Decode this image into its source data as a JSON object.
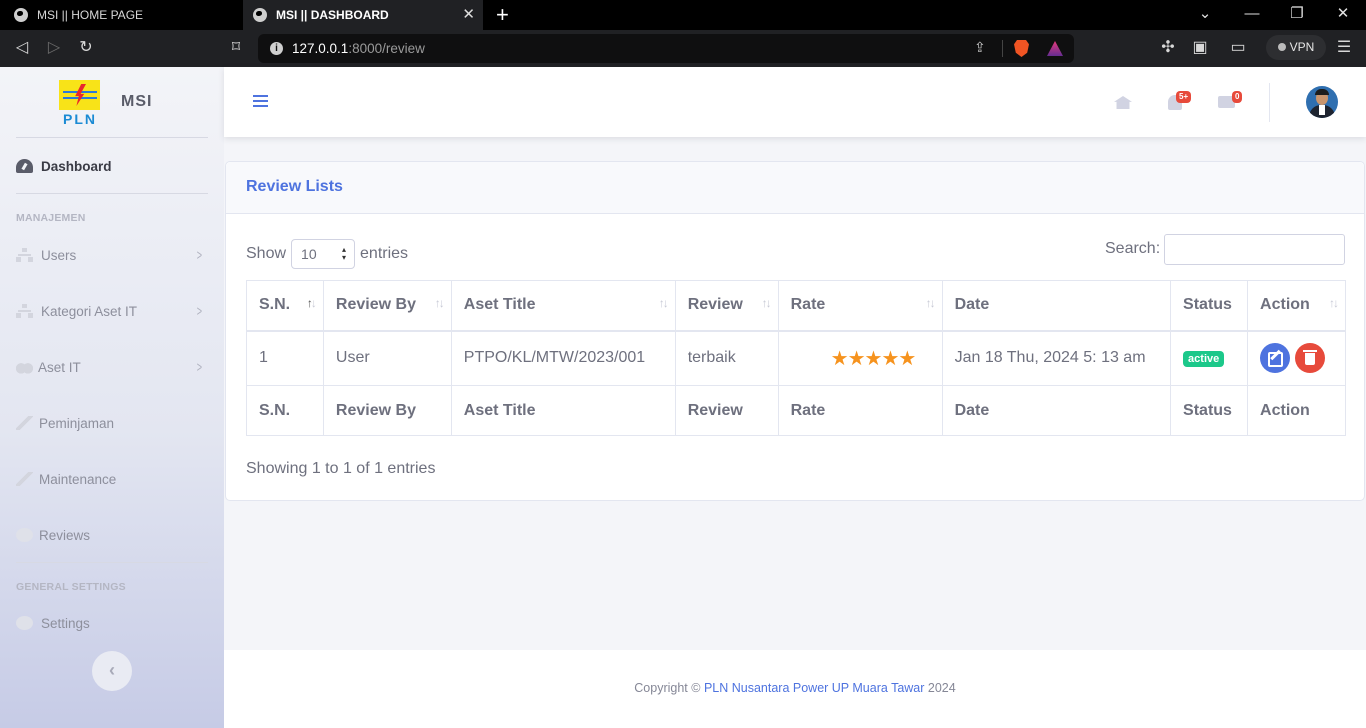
{
  "browser": {
    "tabs": [
      {
        "title": "MSI || HOME PAGE",
        "active": false
      },
      {
        "title": "MSI || DASHBOARD",
        "active": true
      }
    ],
    "url_host": "127.0.0.1",
    "url_rest": ":8000/review",
    "vpn_label": "VPN"
  },
  "sidebar": {
    "brand_logo_text": "PLN",
    "brand_name": "MSI",
    "dashboard_label": "Dashboard",
    "heading_manajemen": "MANAJEMEN",
    "items": [
      {
        "label": "Users",
        "icon": "sitemap-icon"
      },
      {
        "label": "Kategori Aset IT",
        "icon": "sitemap-icon"
      },
      {
        "label": "Aset IT",
        "icon": "cubes-icon"
      },
      {
        "label": "Peminjaman",
        "icon": "tool-icon"
      },
      {
        "label": "Maintenance",
        "icon": "tool-icon"
      },
      {
        "label": "Reviews",
        "icon": "comments-icon"
      }
    ],
    "heading_general": "GENERAL SETTINGS",
    "settings_label": "Settings"
  },
  "topbar": {
    "alerts_badge": "5+",
    "messages_badge": "0"
  },
  "card": {
    "title": "Review Lists",
    "show_label": "Show",
    "entries_label": "entries",
    "page_length": "10",
    "search_label": "Search:",
    "search_value": "",
    "columns": [
      "S.N.",
      "Review By",
      "Aset Title",
      "Review",
      "Rate",
      "Date",
      "Status",
      "Action"
    ],
    "rows": [
      {
        "sn": "1",
        "review_by": "User",
        "aset_title": "PTPO/KL/MTW/2023/001",
        "review": "terbaik",
        "rate": 5,
        "date": "Jan 18 Thu, 2024 5: 13 am",
        "status": "active"
      }
    ],
    "info": "Showing 1 to 1 of 1 entries"
  },
  "footer": {
    "prefix": "Copyright ©",
    "link": "PLN Nusantara Power UP Muara Tawar",
    "year": "2024"
  },
  "colors": {
    "primary": "#4e73df",
    "success": "#1cc88a",
    "danger": "#e74a3b",
    "star": "#f6931e"
  }
}
